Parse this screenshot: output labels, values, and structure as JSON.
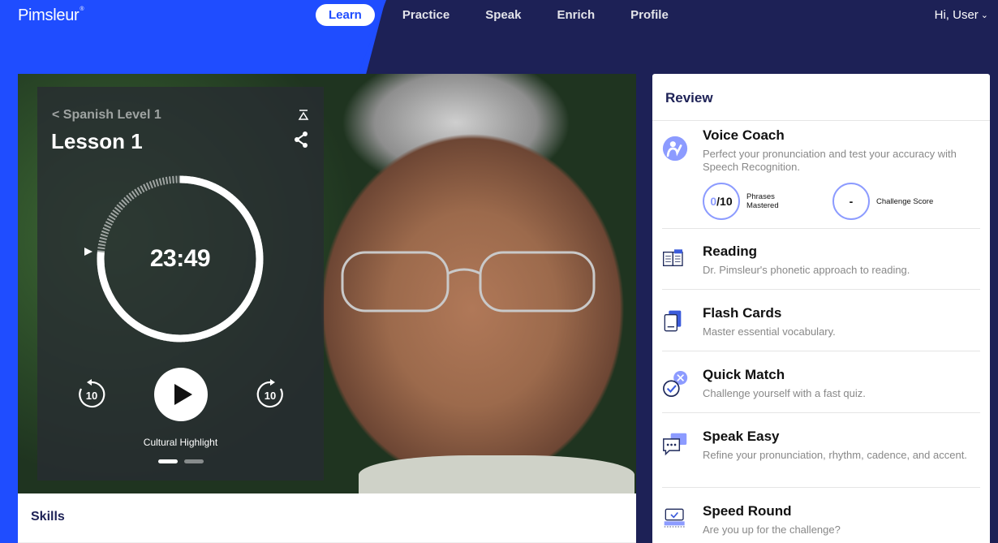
{
  "header": {
    "logo": "Pimsleur",
    "logo_mark": "®",
    "nav": [
      "Learn",
      "Practice",
      "Speak",
      "Enrich",
      "Profile"
    ],
    "user": "Hi, User"
  },
  "player": {
    "breadcrumb": "Spanish Level 1",
    "lesson_title": "Lesson 1",
    "time": "23:49",
    "rewind_label": "10",
    "forward_label": "10",
    "track_label": "Cultural Highlight"
  },
  "skills": {
    "title": "Skills"
  },
  "review": {
    "title": "Review",
    "items": [
      {
        "title": "Voice Coach",
        "desc": "Perfect your pronunciation and test your accuracy with Speech Recognition."
      },
      {
        "title": "Reading",
        "desc": "Dr. Pimsleur's phonetic approach to reading."
      },
      {
        "title": "Flash Cards",
        "desc": "Master essential vocabulary."
      },
      {
        "title": "Quick Match",
        "desc": "Challenge yourself with a fast quiz."
      },
      {
        "title": "Speak Easy",
        "desc": "Refine your pronunciation, rhythm, cadence, and accent."
      },
      {
        "title": "Speed Round",
        "desc": "Are you up for the challenge?"
      }
    ],
    "voice_coach_stats": {
      "phrases_mastered": "0",
      "phrases_total": "/10",
      "phrases_label_1": "Phrases",
      "phrases_label_2": "Mastered",
      "challenge_score": "-",
      "challenge_label": "Challenge Score"
    }
  },
  "colors": {
    "brand_blue": "#1f4dff",
    "navy": "#1d2156",
    "icon_blue": "#3b5bdb",
    "icon_light": "#8c9bff"
  }
}
